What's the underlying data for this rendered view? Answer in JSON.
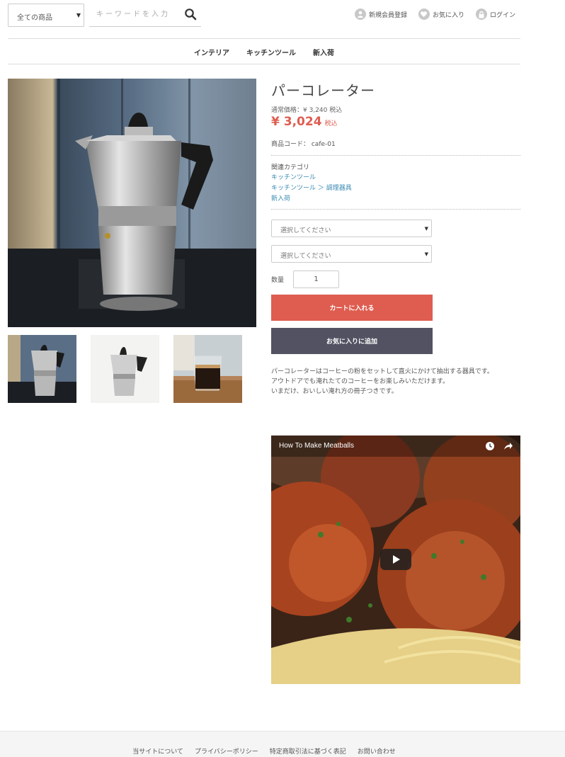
{
  "header": {
    "category_select": "全ての商品",
    "search_placeholder": "キーワードを入力",
    "user_links": [
      {
        "label": "新規会員登録",
        "icon": "user-icon"
      },
      {
        "label": "お気に入り",
        "icon": "heart-icon"
      },
      {
        "label": "ログイン",
        "icon": "lock-icon"
      }
    ]
  },
  "nav": [
    "インテリア",
    "キッチンツール",
    "新入荷"
  ],
  "product": {
    "title": "パーコレーター",
    "regular_price": "通常価格：¥ 3,240 税込",
    "price": "¥ 3,024",
    "price_tax": "税込",
    "code": "商品コード： cafe-01",
    "category_heading": "関連カテゴリ",
    "categories": [
      "キッチンツール",
      "キッチンツール ＞ 調理器具",
      "新入荷"
    ],
    "option1": "選択してください",
    "option2": "選択してください",
    "qty_label": "数量",
    "qty": "1",
    "cart_button": "カートに入れる",
    "fav_button": "お気に入りに追加",
    "description": [
      "パーコレーターはコーヒーの粉をセットして直火にかけて抽出する器具です。",
      "アウトドアでも淹れたてのコーヒーをお楽しみいただけます。",
      "いまだけ、おいしい淹れ方の冊子つきです。"
    ]
  },
  "video": {
    "title": "How To Make Meatballs"
  },
  "footer": {
    "links": [
      "当サイトについて",
      "プライバシーポリシー",
      "特定商取引法に基づく表記",
      "お問い合わせ"
    ]
  },
  "colors": {
    "accent": "#de5d50",
    "secondary": "#525263",
    "link": "#3a8ab3"
  }
}
